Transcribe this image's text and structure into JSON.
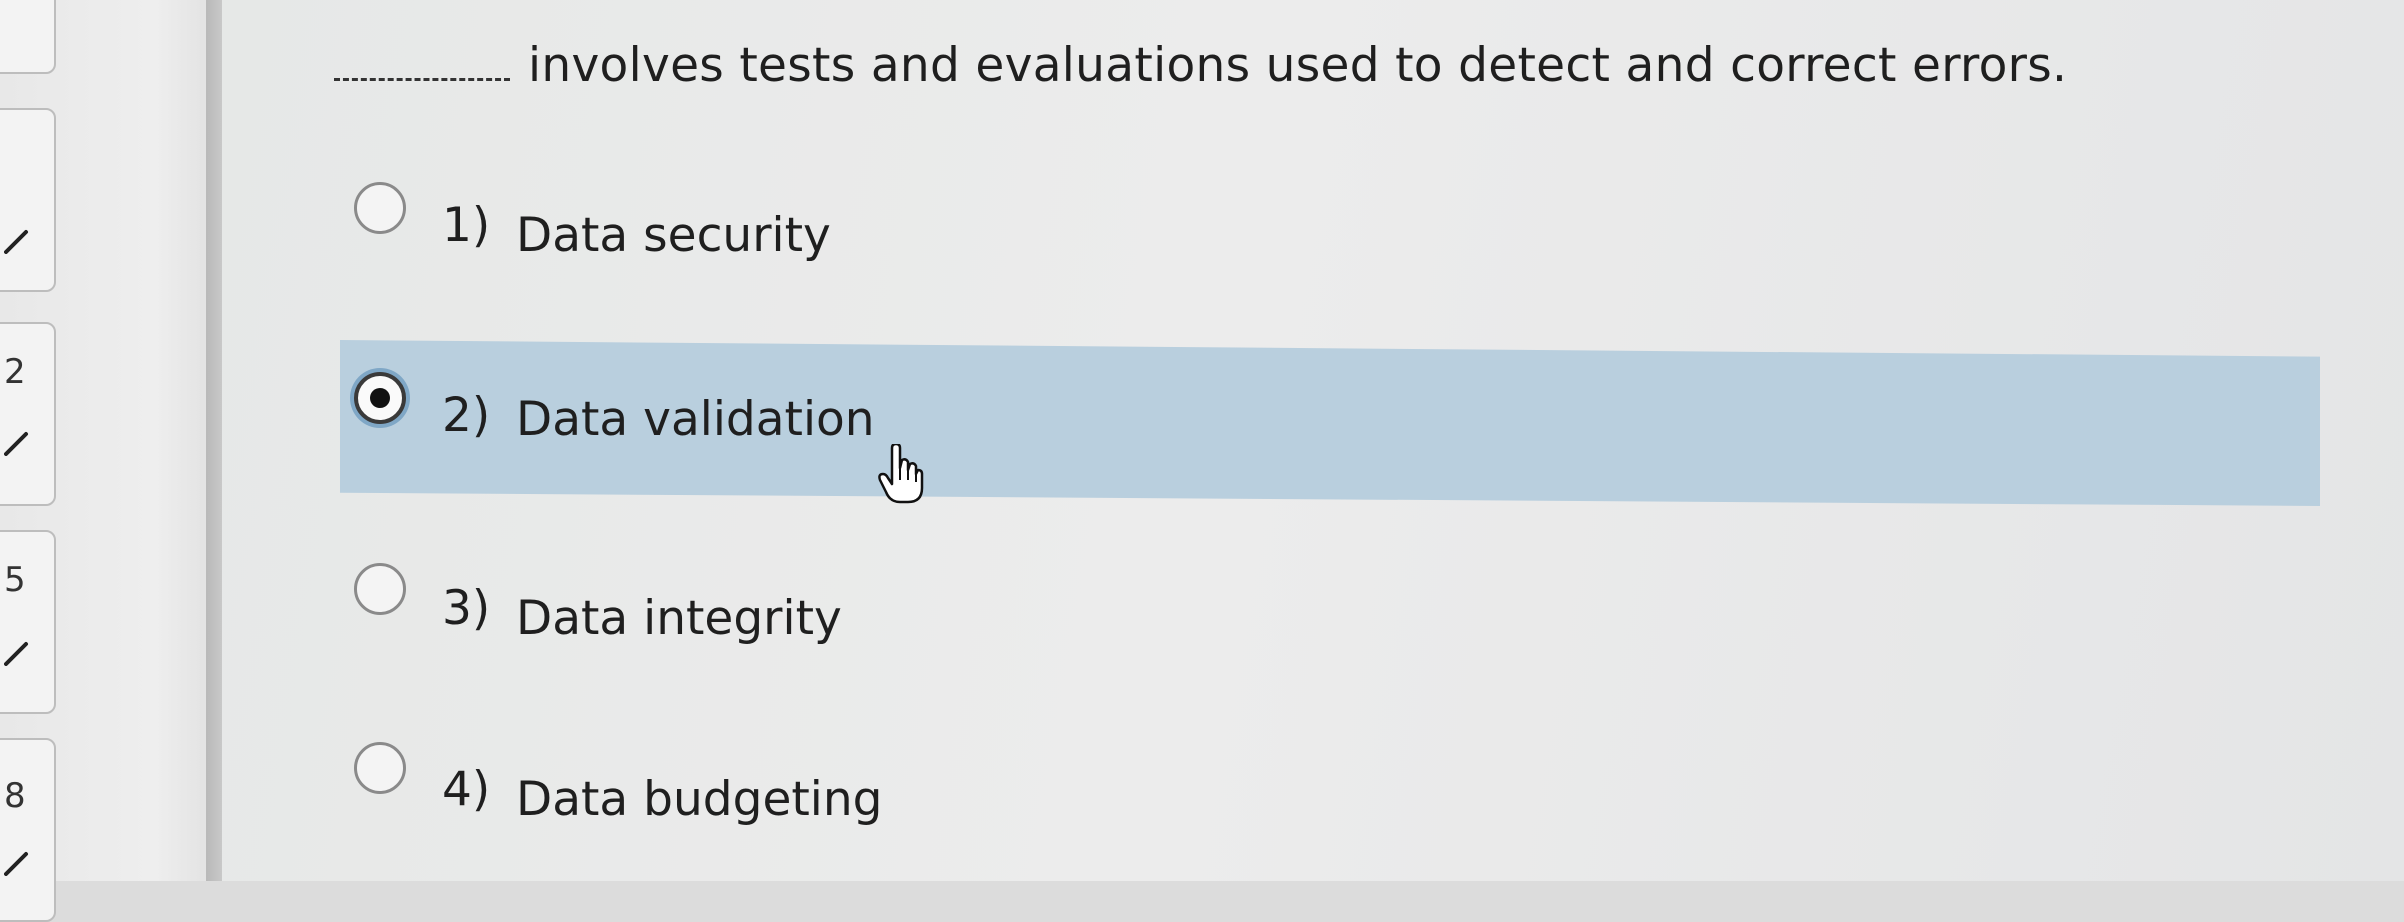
{
  "nav": {
    "items": [
      {
        "number": ""
      },
      {
        "number": ""
      },
      {
        "number": "2"
      },
      {
        "number": "5"
      },
      {
        "number": "8"
      }
    ]
  },
  "question": {
    "blank": "________",
    "text": "involves tests and evaluations used to detect and correct errors."
  },
  "options": [
    {
      "number": "1)",
      "label": "Data security",
      "selected": false
    },
    {
      "number": "2)",
      "label": "Data validation",
      "selected": true
    },
    {
      "number": "3)",
      "label": "Data integrity",
      "selected": false
    },
    {
      "number": "4)",
      "label": "Data budgeting",
      "selected": false
    }
  ],
  "colors": {
    "selected_row": "#b9cfde",
    "radio_focus_ring": "#7fa7c6",
    "text": "#1f1f1f"
  },
  "icons": {
    "cursor": "hand-pointer-icon",
    "nav_status": "checkmark-icon"
  }
}
